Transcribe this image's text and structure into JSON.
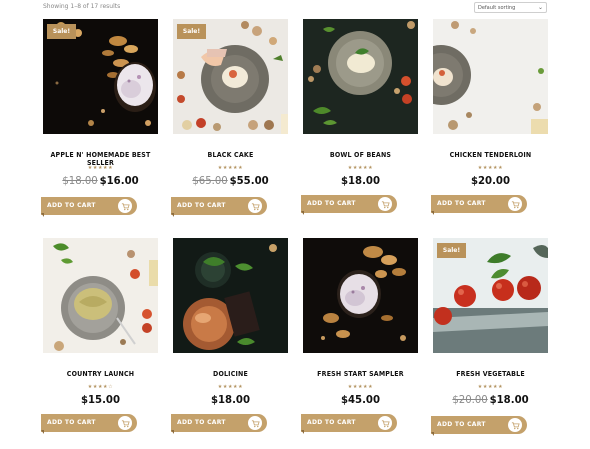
{
  "toolbar": {
    "results_text": "Showing 1–8 of 17 results",
    "sort_selected": "Default sorting"
  },
  "labels": {
    "add_to_cart": "ADD TO CART",
    "sale": "Sale!"
  },
  "colors": {
    "accent": "#c4a16b",
    "accent_dark": "#8c6c3e",
    "star": "#b39360",
    "sale_badge": "#b9925a"
  },
  "products": [
    {
      "name": "APPLE N' HOMEMADE BEST SELLER",
      "old_price": "$18.00",
      "price": "$16.00",
      "sale": true,
      "rating": 5,
      "stars": "★★★★★"
    },
    {
      "name": "BLACK CAKE",
      "old_price": "$65.00",
      "price": "$55.00",
      "sale": true,
      "rating": 5,
      "stars": "★★★★★"
    },
    {
      "name": "BOWL OF BEANS",
      "old_price": "",
      "price": "$18.00",
      "sale": false,
      "rating": 5,
      "stars": "★★★★★"
    },
    {
      "name": "CHICKEN TENDERLOIN",
      "old_price": "",
      "price": "$20.00",
      "sale": false,
      "rating": 5,
      "stars": "★★★★★"
    },
    {
      "name": "COUNTRY LAUNCH",
      "old_price": "",
      "price": "$15.00",
      "sale": false,
      "rating": 4,
      "stars": "★★★★☆"
    },
    {
      "name": "DOLICINE",
      "old_price": "",
      "price": "$18.00",
      "sale": false,
      "rating": 5,
      "stars": "★★★★★"
    },
    {
      "name": "FRESH START SAMPLER",
      "old_price": "",
      "price": "$45.00",
      "sale": false,
      "rating": 5,
      "stars": "★★★★★"
    },
    {
      "name": "FRESH VEGETABLE",
      "old_price": "$20.00",
      "price": "$18.00",
      "sale": true,
      "rating": 5,
      "stars": "★★★★★"
    }
  ]
}
